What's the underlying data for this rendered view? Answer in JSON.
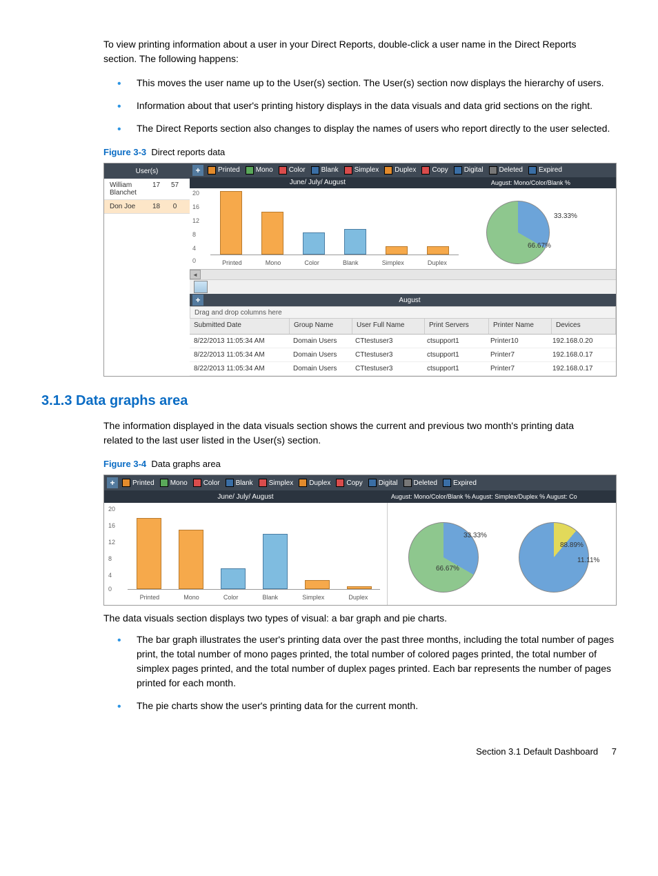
{
  "intro": "To view printing information about a user in your Direct Reports, double-click a user name in the Direct Reports section. The following happens:",
  "intro_bullets": [
    "This moves the user name up to the User(s) section. The User(s) section now displays the hierarchy of users.",
    "Information about that user's printing history displays in the data visuals and data grid sections on the right.",
    "The Direct Reports section also changes to display the names of users who report directly to the user selected."
  ],
  "figure3": {
    "label": "Figure 3-3",
    "title": "Direct reports data",
    "users_header": "User(s)",
    "users": [
      {
        "name": "William Blanchet",
        "a": "17",
        "b": "57"
      },
      {
        "name": "Don Joe",
        "a": "18",
        "b": "0"
      }
    ],
    "legend": [
      {
        "label": "Printed",
        "color": "#e38b2c"
      },
      {
        "label": "Mono",
        "color": "#5aa85a"
      },
      {
        "label": "Color",
        "color": "#d94c4c"
      },
      {
        "label": "Blank",
        "color": "#3a6ea5"
      },
      {
        "label": "Simplex",
        "color": "#d94c4c"
      },
      {
        "label": "Duplex",
        "color": "#e38b2c"
      },
      {
        "label": "Copy",
        "color": "#d94c4c"
      },
      {
        "label": "Digital",
        "color": "#3a6ea5"
      },
      {
        "label": "Deleted",
        "color": "#777"
      },
      {
        "label": "Expired",
        "color": "#3a6ea5"
      }
    ],
    "sub_left": "June/ July/ August",
    "sub_right": "August: Mono/Color/Blank %",
    "pie33": "33.33%",
    "pie66": "66.67%",
    "august": "August",
    "drag": "Drag and drop columns here",
    "columns": [
      "Submitted Date",
      "Group Name",
      "User Full Name",
      "Print Servers",
      "Printer Name",
      "Devices"
    ],
    "rows": [
      [
        "8/22/2013 11:05:34 AM",
        "Domain Users",
        "CTtestuser3",
        "ctsupport1",
        "Printer10",
        "192.168.0.20"
      ],
      [
        "8/22/2013 11:05:34 AM",
        "Domain Users",
        "CTtestuser3",
        "ctsupport1",
        "Printer7",
        "192.168.0.17"
      ],
      [
        "8/22/2013 11:05:34 AM",
        "Domain Users",
        "CTtestuser3",
        "ctsupport1",
        "Printer7",
        "192.168.0.17"
      ]
    ]
  },
  "section_heading": "3.1.3 Data graphs area",
  "section_text": "The information displayed in the data visuals section shows the current and previous two month's printing data related to the last user listed in the User(s) section.",
  "figure4": {
    "label": "Figure 3-4",
    "title": "Data graphs area",
    "sub_left": "June/ July/ August",
    "sub_right": "August: Mono/Color/Blank %   August: Simplex/Duplex %   August: Co",
    "p1a": "33.33%",
    "p1b": "66.67%",
    "p2a": "88.89%",
    "p2b": "11.11%"
  },
  "after_fig4": "The data visuals section displays two types of visual: a bar graph and pie charts.",
  "after_bullets": [
    "The bar graph illustrates the user's printing data over the past three months, including the total number of pages print, the total number of mono pages printed, the total number of colored pages printed, the total number of simplex pages printed, and the total number of duplex pages printed. Each bar represents the number of pages printed for each month.",
    "The pie charts show the user's printing data for the current month."
  ],
  "footer_section": "Section 3.1   Default Dashboard",
  "footer_page": "7",
  "chart_data": [
    {
      "type": "bar",
      "context": "Figure 3-3 bar chart",
      "title": "June/ July/ August",
      "categories": [
        "Printed",
        "Mono",
        "Color",
        "Blank",
        "Simplex",
        "Duplex"
      ],
      "values": [
        18,
        12,
        6,
        7,
        2,
        2
      ],
      "ylim": [
        0,
        20
      ],
      "yticks": [
        0,
        4,
        8,
        12,
        16,
        20
      ]
    },
    {
      "type": "pie",
      "context": "Figure 3-3 pie: August Mono/Color/Blank %",
      "slices": [
        {
          "label": "33.33%",
          "value": 33.33
        },
        {
          "label": "66.67%",
          "value": 66.67
        }
      ]
    },
    {
      "type": "bar",
      "context": "Figure 3-4 bar chart",
      "title": "June/ July/ August",
      "categories": [
        "Printed",
        "Mono",
        "Color",
        "Blank",
        "Simplex",
        "Duplex"
      ],
      "values": [
        18,
        15,
        5,
        14,
        2,
        0
      ],
      "ylim": [
        0,
        20
      ],
      "yticks": [
        0,
        4,
        8,
        12,
        16,
        20
      ]
    },
    {
      "type": "pie",
      "context": "Figure 3-4 pie 1: August Mono/Color/Blank %",
      "slices": [
        {
          "label": "33.33%",
          "value": 33.33
        },
        {
          "label": "66.67%",
          "value": 66.67
        }
      ]
    },
    {
      "type": "pie",
      "context": "Figure 3-4 pie 2: August Simplex/Duplex %",
      "slices": [
        {
          "label": "88.89%",
          "value": 88.89
        },
        {
          "label": "11.11%",
          "value": 11.11
        }
      ]
    }
  ]
}
